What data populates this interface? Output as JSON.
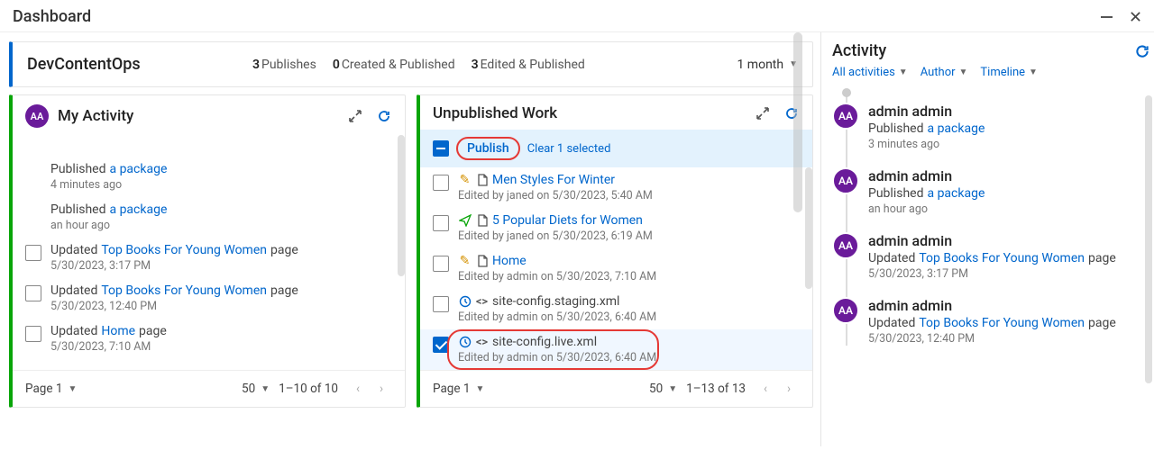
{
  "window": {
    "title": "Dashboard"
  },
  "project": {
    "name": "DevContentOps",
    "stats": [
      {
        "count": "3",
        "label": "Publishes"
      },
      {
        "count": "0",
        "label": "Created & Published"
      },
      {
        "count": "3",
        "label": "Edited & Published"
      }
    ],
    "range": "1 month"
  },
  "myActivity": {
    "title": "My Activity",
    "avatar": "AA",
    "items": [
      {
        "checkbox": false,
        "pre": "Published ",
        "link": "a package",
        "meta": "4 minutes ago"
      },
      {
        "checkbox": false,
        "pre": "Published ",
        "link": "a package",
        "meta": "an hour ago"
      },
      {
        "checkbox": true,
        "pre": "Updated ",
        "link": "Top Books For Young Women",
        "suf": " page",
        "meta": "5/30/2023, 3:17 PM"
      },
      {
        "checkbox": true,
        "pre": "Updated ",
        "link": "Top Books For Young Women",
        "suf": " page",
        "meta": "5/30/2023, 12:40 PM"
      },
      {
        "checkbox": true,
        "pre": "Updated ",
        "link": "Home",
        "suf": " page",
        "meta": "5/30/2023, 7:10 AM"
      }
    ],
    "footer": {
      "page": "Page 1",
      "size": "50",
      "range": "1–10 of 10"
    }
  },
  "unpub": {
    "title": "Unpublished Work",
    "selbar": {
      "publish": "Publish",
      "clear": "Clear 1 selected"
    },
    "items": [
      {
        "checked": false,
        "icons": [
          "pen",
          "file"
        ],
        "link": "Men Styles For Winter",
        "meta": "Edited by janed on 5/30/2023, 5:40 AM"
      },
      {
        "checked": false,
        "icons": [
          "paper",
          "file"
        ],
        "link": "5 Popular Diets for Women",
        "meta": "Edited by janed on 5/30/2023, 6:19 AM"
      },
      {
        "checked": false,
        "icons": [
          "pen",
          "file"
        ],
        "link": "Home",
        "meta": "Edited by admin on 5/30/2023, 7:10 AM"
      },
      {
        "checked": false,
        "icons": [
          "clock",
          "code"
        ],
        "text": "site-config.staging.xml",
        "meta": "Edited by admin on 5/30/2023, 6:40 AM"
      },
      {
        "checked": true,
        "flagged": true,
        "icons": [
          "clock",
          "code"
        ],
        "text": "site-config.live.xml",
        "meta": "Edited by admin on 5/30/2023, 6:40 AM"
      }
    ],
    "footer": {
      "page": "Page 1",
      "size": "50",
      "range": "1–13 of 13"
    }
  },
  "activity": {
    "title": "Activity",
    "filters": [
      "All activities",
      "Author",
      "Timeline"
    ],
    "items": [
      {
        "avatar": "AA",
        "user": "admin admin",
        "pre": "Published ",
        "link": "a package",
        "meta": "3 minutes ago"
      },
      {
        "avatar": "AA",
        "user": "admin admin",
        "pre": "Published ",
        "link": "a package",
        "meta": "an hour ago"
      },
      {
        "avatar": "AA",
        "user": "admin admin",
        "pre": "Updated ",
        "link": "Top Books For Young Women",
        "suf": " page",
        "meta": "5/30/2023, 3:17 PM"
      },
      {
        "avatar": "AA",
        "user": "admin admin",
        "pre": "Updated ",
        "link": "Top Books For Young Women",
        "suf": " page",
        "meta": "5/30/2023, 12:40 PM"
      }
    ]
  }
}
